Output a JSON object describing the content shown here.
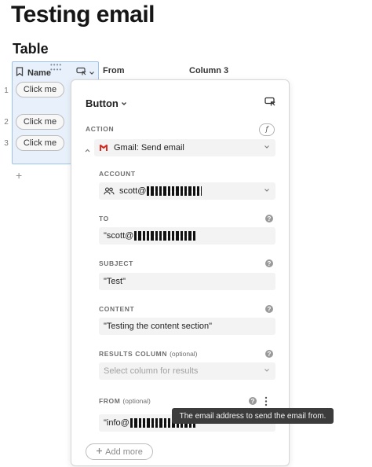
{
  "page": {
    "title": "Testing email"
  },
  "section": {
    "title": "Table"
  },
  "table": {
    "columns": [
      {
        "label": "Name"
      },
      {
        "label": "From"
      },
      {
        "label": "Column 3"
      }
    ],
    "rows": [
      {
        "num": "1",
        "button": "Click me"
      },
      {
        "num": "2",
        "button": "Click me"
      },
      {
        "num": "3",
        "button": "Click me"
      }
    ],
    "add_row": "+"
  },
  "panel": {
    "title": "Button",
    "action_label": "ACTION",
    "formula_symbol": "f",
    "action_value": "Gmail: Send email",
    "account": {
      "label": "ACCOUNT",
      "value": "scott@"
    },
    "to": {
      "label": "TO",
      "value": "\"scott@"
    },
    "subject": {
      "label": "SUBJECT",
      "value": "\"Test\""
    },
    "content": {
      "label": "CONTENT",
      "value": "\"Testing the content section\""
    },
    "results_column": {
      "label": "RESULTS COLUMN",
      "optional": "(optional)",
      "placeholder": "Select column for results"
    },
    "from": {
      "label": "FROM",
      "optional": "(optional)",
      "value": "\"info@"
    },
    "add_more": "Add more"
  },
  "tooltip": "The email address to send the email from.",
  "colors": {
    "accent_selection": "#e8f1fb",
    "selection_border": "#9ec3ea",
    "gmail_red": "#d93025"
  },
  "icons": [
    "bookmark-icon",
    "column-type-icon",
    "chevron-down-icon",
    "gmail-icon",
    "people-icon",
    "help-icon",
    "more-vertical-icon",
    "plus-icon",
    "formula-icon"
  ]
}
